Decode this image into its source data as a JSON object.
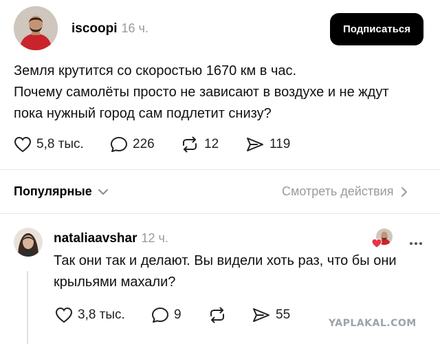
{
  "post": {
    "username": "iscoopi",
    "time": "16 ч.",
    "follow_label": "Подписаться",
    "text_lines": [
      "Земля крутится со скоростью 1670 км в час.",
      "Почему самолёты просто не зависают в воздухе и не ждут",
      "пока нужный город сам подлетит снизу?"
    ],
    "likes": "5,8 тыс.",
    "comments": "226",
    "reposts": "12",
    "shares": "119"
  },
  "sort_bar": {
    "label": "Популярные",
    "view_activity": "Смотреть действия"
  },
  "reply": {
    "username": "nataliaavshar",
    "time": "12 ч.",
    "text_lines": [
      "Так они так и делают. Вы видели хоть раз, что бы они",
      "крыльями махали?"
    ],
    "likes": "3,8 тыс.",
    "comments": "9",
    "shares": "55"
  },
  "watermark": "YAPLAKAL.COM",
  "icons": {
    "like": "heart-icon",
    "comment": "speech-bubble-icon",
    "repost": "repost-icon",
    "share": "send-icon",
    "chevron_down": "chevron-down-icon",
    "chevron_right": "chevron-right-icon",
    "more": "more-dots-icon",
    "liked_badge": "red-heart-icon"
  },
  "colors": {
    "follow_button": "#000000",
    "muted_text": "#9a9a9a",
    "liked_heart": "#e8334a"
  }
}
